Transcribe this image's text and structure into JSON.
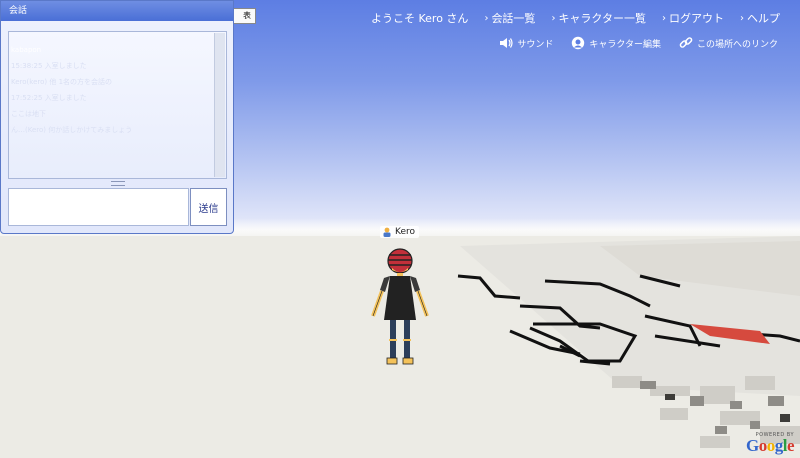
{
  "header": {
    "welcome": "ようこそ Kero さん",
    "links": [
      {
        "label": "会話一覧"
      },
      {
        "label": "キャラクター一覧"
      },
      {
        "label": "ログアウト"
      },
      {
        "label": "ヘルプ"
      }
    ]
  },
  "tools": {
    "sound_label": "サウンド",
    "character_edit_label": "キャラクター編集",
    "link_label": "この場所へのリンク"
  },
  "chat": {
    "title": "会話",
    "log": [
      "kabapon",
      "15:38:25 入室しました",
      "Kero(kero) 他 1名の方を会話の",
      "17:52:25 入室しました",
      "ここは地下",
      "ん…(Kero) 何か話しかけてみましょう"
    ],
    "input_value": "",
    "send_label": "送信"
  },
  "scene": {
    "view_button_label": "表",
    "avatar_name": "Kero"
  },
  "branding": {
    "powered_by": "POWERED BY",
    "logo_text": "Google"
  },
  "colors": {
    "sky_top": "#5d7ee3",
    "chat_title": "#4a6fd6",
    "send_text": "#2a3a8c"
  }
}
